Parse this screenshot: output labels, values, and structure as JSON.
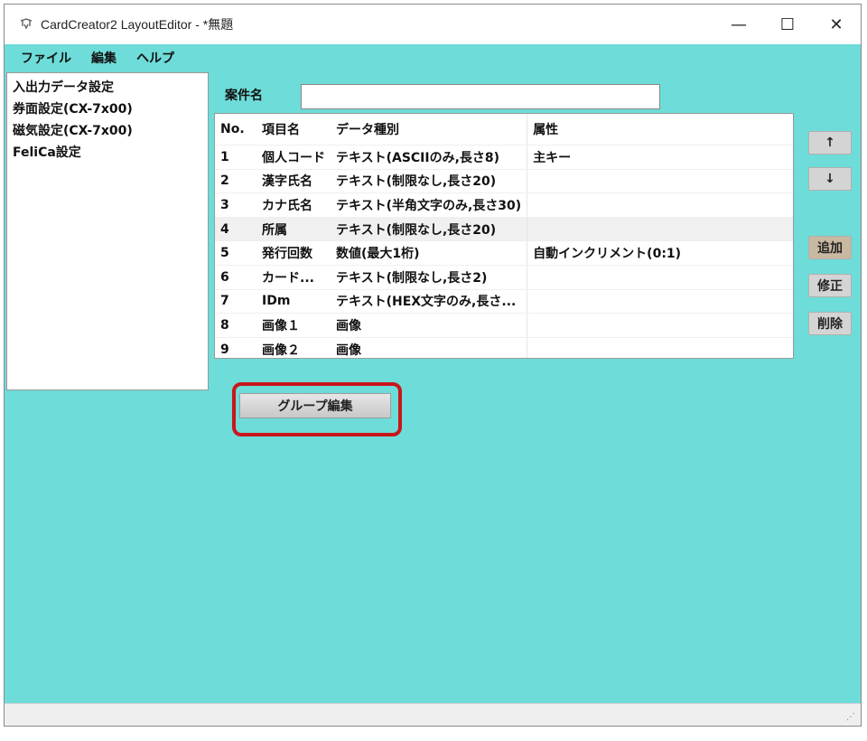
{
  "window": {
    "title": "CardCreator2 LayoutEditor - *無題",
    "controls": {
      "minimize": "—",
      "maximize": "☐",
      "close": "✕"
    }
  },
  "menu": [
    "ファイル",
    "編集",
    "ヘルプ"
  ],
  "tree": [
    "入出力データ設定",
    "券面設定(CX-7x00)",
    "磁気設定(CX-7x00)",
    "FeliCa設定"
  ],
  "case": {
    "label": "案件名",
    "value": ""
  },
  "table": {
    "headers": {
      "no": "No.",
      "name": "項目名",
      "type": "データ種別",
      "attr": "属性"
    },
    "rows": [
      {
        "no": "1",
        "name": "個人コード",
        "type": "テキスト(ASCIIのみ,長さ8)",
        "attr": "主キー"
      },
      {
        "no": "2",
        "name": "漢字氏名",
        "type": "テキスト(制限なし,長さ20)",
        "attr": ""
      },
      {
        "no": "3",
        "name": "カナ氏名",
        "type": "テキスト(半角文字のみ,長さ30)",
        "attr": ""
      },
      {
        "no": "4",
        "name": "所属",
        "type": "テキスト(制限なし,長さ20)",
        "attr": ""
      },
      {
        "no": "5",
        "name": "発行回数",
        "type": "数値(最大1桁)",
        "attr": "自動インクリメント(0:1)"
      },
      {
        "no": "6",
        "name": "カード...",
        "type": "テキスト(制限なし,長さ2)",
        "attr": ""
      },
      {
        "no": "7",
        "name": "IDm",
        "type": "テキスト(HEX文字のみ,長さ...",
        "attr": ""
      },
      {
        "no": "8",
        "name": "画像１",
        "type": "画像",
        "attr": ""
      },
      {
        "no": "9",
        "name": "画像２",
        "type": "画像",
        "attr": ""
      }
    ]
  },
  "side_buttons": {
    "up": "↑",
    "down": "↓",
    "add": "追加",
    "edit": "修正",
    "delete": "削除"
  },
  "group_button": "グループ編集",
  "colors": {
    "background": "#6edcd8",
    "highlight_frame": "#c8161b"
  }
}
